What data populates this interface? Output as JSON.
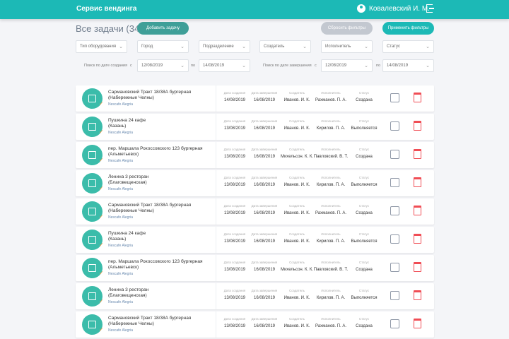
{
  "header": {
    "brand": "Сервис вендинга",
    "user": "Ковалевский И. М."
  },
  "toolbar": {
    "title": "Все задачи (34)",
    "add": "Добавить задачу",
    "reset": "Сбросить фильтры",
    "apply": "Применить фильтры"
  },
  "filters": [
    "Тип оборудования",
    "Город",
    "Подразделение",
    "Создатель",
    "Исполнитель",
    "Статус"
  ],
  "dates": {
    "created_label": "Поиск по дате создания",
    "finished_label": "Поиск по дате завершения",
    "from": "с",
    "to": "по",
    "c_from": "12/08/2019",
    "c_to": "14/08/2019",
    "f_from": "12/08/2019",
    "f_to": "14/08/2019"
  },
  "columns": {
    "created": "Дата создания",
    "finished": "Дата завершения",
    "creator": "Создатель",
    "executor": "Исполнитель",
    "status": "Статус"
  },
  "rows": [
    {
      "name": "Сармановский Тракт 18/38А бургерная",
      "city": "(Набережные Челны)",
      "brand": "Nescafe Alegria",
      "created": "14/08/2019",
      "finished": "16/08/2019",
      "creator": "Иванов. И. К.",
      "executor": "Рахманов. П. А.",
      "status": "Создана"
    },
    {
      "name": "Пушкина 24 кафе",
      "city": "(Казань)",
      "brand": "Nescafe Alegria",
      "created": "13/08/2019",
      "finished": "16/08/2019",
      "creator": "Иванов. И. К.",
      "executor": "Кирилов. П. А.",
      "status": "Выполняется"
    },
    {
      "name": "пер. Маршала Рокоссовского 123 бургерная",
      "city": "(Альметьевск)",
      "brand": "Nescafe Alegria",
      "created": "13/08/2019",
      "finished": "16/08/2019",
      "creator": "Михельсон. К. К.",
      "executor": "Павловский. В. Т.",
      "status": "Создана"
    },
    {
      "name": "Ленина 3 ресторан",
      "city": "(Благовещенская)",
      "brand": "Nescafe Alegria",
      "created": "13/08/2019",
      "finished": "16/08/2019",
      "creator": "Иванов. И. К.",
      "executor": "Кирилов. П. А.",
      "status": "Выполняется"
    },
    {
      "name": "Сармановский Тракт 18/38А бургерная",
      "city": "(Набережные Челны)",
      "brand": "Nescafe Alegria",
      "created": "13/08/2019",
      "finished": "16/08/2019",
      "creator": "Иванов. И. К.",
      "executor": "Рахманов. П. А.",
      "status": "Создана"
    },
    {
      "name": "Пушкина 24 кафе",
      "city": "(Казань)",
      "brand": "Nescafe Alegria",
      "created": "13/08/2019",
      "finished": "16/08/2019",
      "creator": "Иванов. И. К.",
      "executor": "Кирилов. П. А.",
      "status": "Выполняется"
    },
    {
      "name": "пер. Маршала Рокоссовского 123 бургерная",
      "city": "(Альметьевск)",
      "brand": "Nescafe Alegria",
      "created": "13/08/2019",
      "finished": "16/08/2019",
      "creator": "Михельсон. К. К.",
      "executor": "Павловский. В. Т.",
      "status": "Создана"
    },
    {
      "name": "Ленина 3 ресторан",
      "city": "(Благовещенская)",
      "brand": "Nescafe Alegria",
      "created": "13/08/2019",
      "finished": "16/08/2019",
      "creator": "Иванов. И. К.",
      "executor": "Кирилов. П. А.",
      "status": "Выполняется"
    },
    {
      "name": "Сармановский Тракт 18/38А бургерная",
      "city": "(Набережные Челны)",
      "brand": "Nescafe Alegria",
      "created": "13/08/2019",
      "finished": "16/08/2019",
      "creator": "Иванов. И. К.",
      "executor": "Рахманов. П. А.",
      "status": "Создана"
    }
  ]
}
